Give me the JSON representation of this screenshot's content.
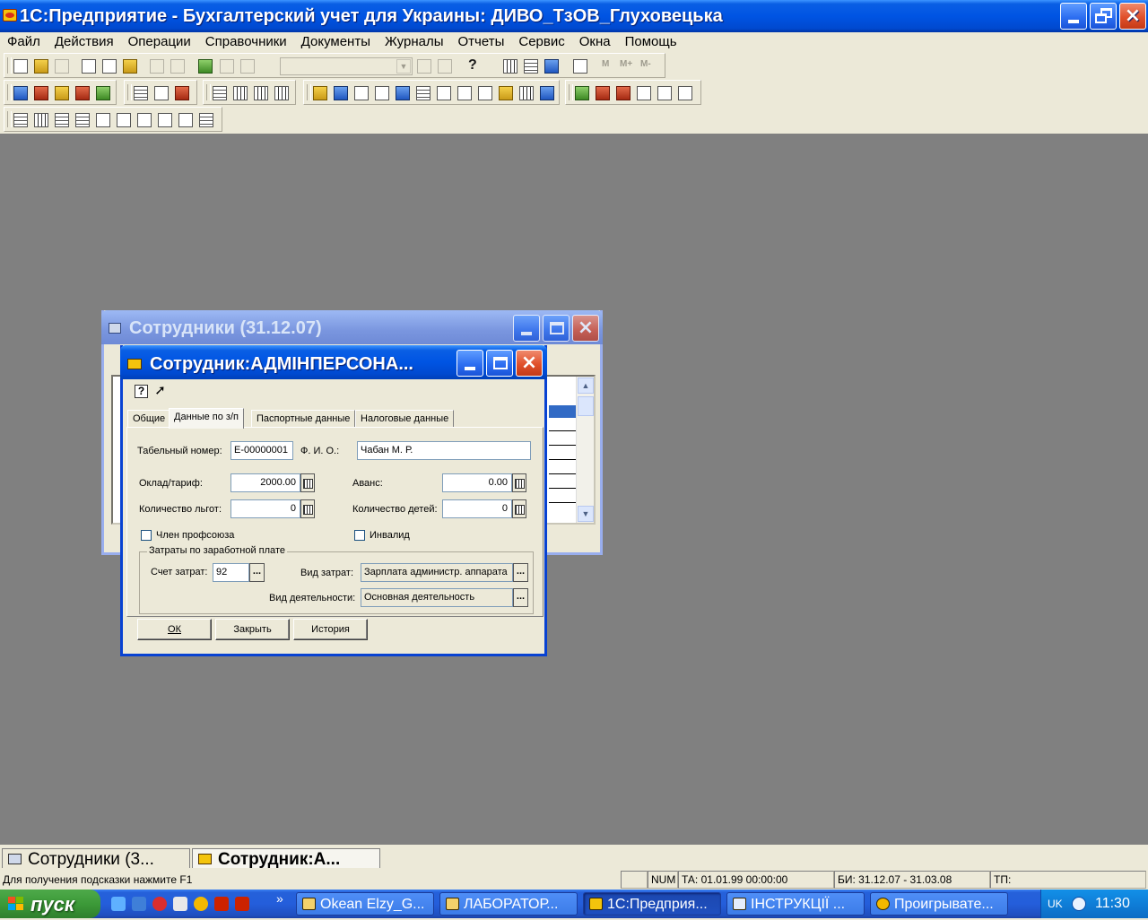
{
  "main_window": {
    "title": "1С:Предприятие - Бухгалтерский учет для Украины: ДИВО_ТзОВ_Глуховецька"
  },
  "menu": {
    "items": [
      "Файл",
      "Действия",
      "Операции",
      "Справочники",
      "Документы",
      "Журналы",
      "Отчеты",
      "Сервис",
      "Окна",
      "Помощь"
    ]
  },
  "toolbar": {
    "help_glyph": "?",
    "m_labels": [
      "M",
      "M+",
      "M-"
    ]
  },
  "employees_list_window": {
    "title": "Сотрудники (31.12.07)"
  },
  "employee_dialog": {
    "title": "Сотрудник:АДМІНПЕРСОНА...",
    "tabs": [
      "Общие",
      "Данные по з/п",
      "Паспортные данные",
      "Налоговые данные"
    ],
    "active_tab": "Данные по з/п",
    "fields": {
      "tab_number_label": "Табельный номер:",
      "tab_number_value": "Е-00000001",
      "fio_label": "Ф. И. О.:",
      "fio_value": "Чабан М. Р.",
      "salary_label": "Оклад/тариф:",
      "salary_value": "2000.00",
      "advance_label": "Аванс:",
      "advance_value": "0.00",
      "benefits_label": "Количество льгот:",
      "benefits_value": "0",
      "children_label": "Количество детей:",
      "children_value": "0",
      "union_label": "Член профсоюза",
      "invalid_label": "Инвалид"
    },
    "costs_group": {
      "title": "Затраты по заработной плате",
      "account_label": "Счет затрат:",
      "account_value": "92",
      "cost_type_label": "Вид затрат:",
      "cost_type_value": "Зарплата администр. аппарата",
      "activity_label": "Вид деятельности:",
      "activity_value": "Основная деятельность"
    },
    "buttons": {
      "ok": "ОК",
      "close": "Закрыть",
      "history": "История"
    },
    "ellipsis": "..."
  },
  "window_bar": {
    "tabs": [
      "Сотрудники (3...",
      "Сотрудник:А..."
    ]
  },
  "status_bar": {
    "hint": "Для получения подсказки нажмите F1",
    "num": "NUM",
    "ta": "ТА: 01.01.99  00:00:00",
    "bi": "БИ: 31.12.07 - 31.03.08",
    "tp": "ТП:"
  },
  "taskbar": {
    "start_label": "пуск",
    "chevron": "»",
    "tasks": [
      "Okean Elzy_G...",
      "ЛАБОРАТОР...",
      "1С:Предприя...",
      "ІНСТРУКЦІЇ ...",
      "Проигрывате..."
    ],
    "active_task": "1С:Предприя...",
    "lang": "UK",
    "clock": "11:30"
  }
}
